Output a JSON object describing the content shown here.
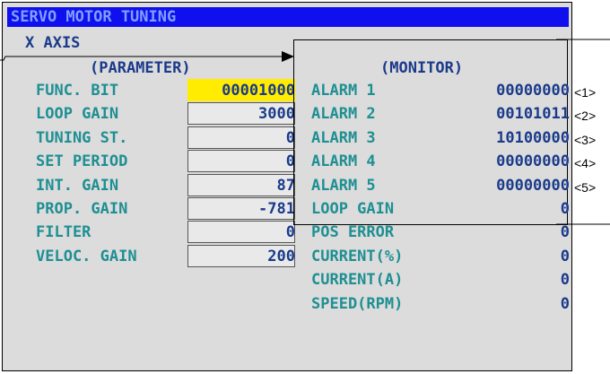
{
  "title": "SERVO MOTOR TUNING",
  "axis": "X AXIS",
  "parameter": {
    "header": "(PARAMETER)",
    "rows": [
      {
        "label": "FUNC. BIT",
        "value": "00001000"
      },
      {
        "label": "LOOP GAIN",
        "value": "3000"
      },
      {
        "label": "TUNING ST.",
        "value": "0"
      },
      {
        "label": "SET PERIOD",
        "value": "0"
      },
      {
        "label": "INT. GAIN",
        "value": "87"
      },
      {
        "label": "PROP. GAIN",
        "value": "-781"
      },
      {
        "label": "FILTER",
        "value": "0"
      },
      {
        "label": "VELOC. GAIN",
        "value": "200"
      }
    ]
  },
  "monitor": {
    "header": "(MONITOR)",
    "rows": [
      {
        "label": "ALARM 1",
        "value": "00000000"
      },
      {
        "label": "ALARM 2",
        "value": "00101011"
      },
      {
        "label": "ALARM 3",
        "value": "10100000"
      },
      {
        "label": "ALARM 4",
        "value": "00000000"
      },
      {
        "label": "ALARM 5",
        "value": "00000000"
      },
      {
        "label": "LOOP GAIN",
        "value": "0"
      },
      {
        "label": "POS ERROR",
        "value": "0"
      },
      {
        "label": "CURRENT(%)",
        "value": "0"
      },
      {
        "label": "CURRENT(A)",
        "value": "0"
      },
      {
        "label": "SPEED(RPM)",
        "value": "0"
      }
    ]
  },
  "callouts": [
    "<1>",
    "<2>",
    "<3>",
    "<4>",
    "<5>"
  ],
  "colors": {
    "title_bar": "#1010ee",
    "title_text": "#7fa0ff",
    "label": "#1e8f92",
    "value": "#1a3a8a",
    "highlight": "#ffec00",
    "background": "#dcdcdc"
  }
}
